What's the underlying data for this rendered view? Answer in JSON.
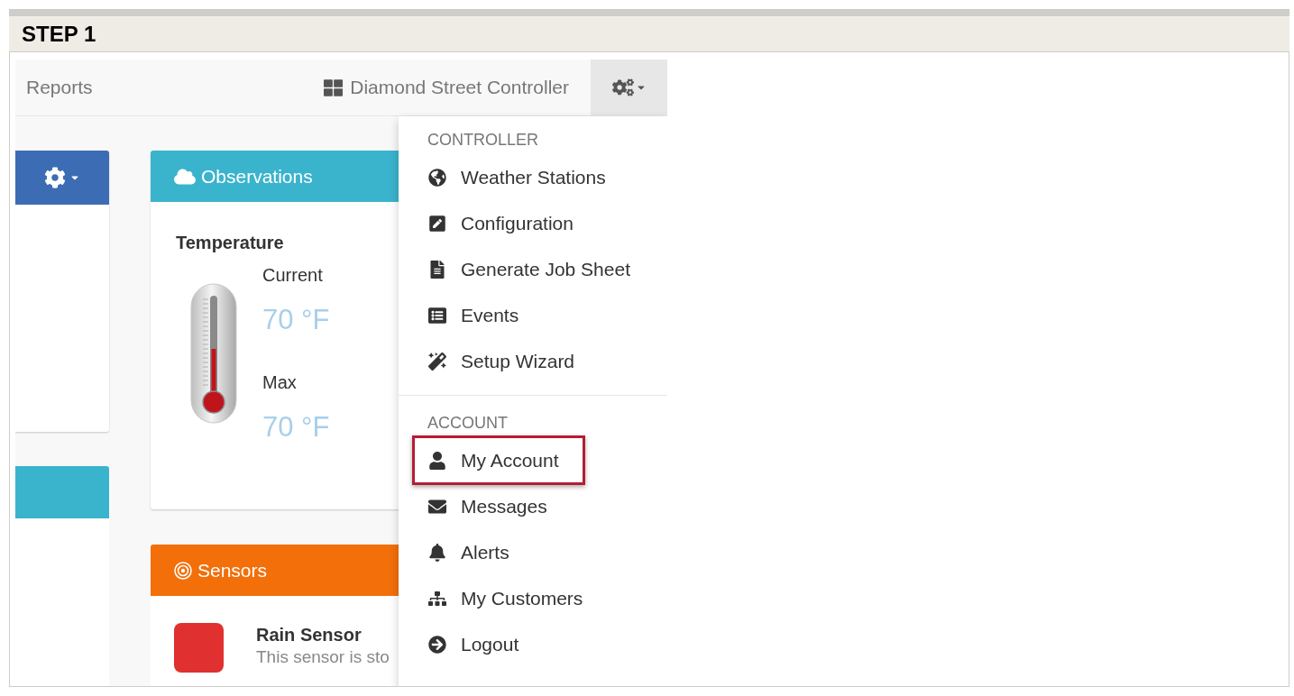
{
  "step_title": "STEP 1",
  "navbar": {
    "reports": "Reports",
    "controller_name": "Diamond Street Controller",
    "settings_menu_open": true
  },
  "observations": {
    "title": "Observations",
    "section": "Temperature",
    "thermometer": {
      "level": 0.45
    },
    "readings": [
      {
        "label": "Current",
        "value": "70 °F"
      },
      {
        "label": "Max",
        "value": "70 °F"
      }
    ]
  },
  "sensors": {
    "title": "Sensors",
    "items": [
      {
        "name": "Rain Sensor",
        "description": "This sensor is sto",
        "color": "#e03030"
      }
    ]
  },
  "menu": {
    "sections": [
      {
        "header": "CONTROLLER",
        "items": [
          {
            "label": "Weather Stations",
            "highlighted": false
          },
          {
            "label": "Configuration",
            "highlighted": false
          },
          {
            "label": "Generate Job Sheet",
            "highlighted": false
          },
          {
            "label": "Events",
            "highlighted": false
          },
          {
            "label": "Setup Wizard",
            "highlighted": false
          }
        ]
      },
      {
        "header": "ACCOUNT",
        "items": [
          {
            "label": "My Account",
            "highlighted": true
          },
          {
            "label": "Messages",
            "highlighted": false
          },
          {
            "label": "Alerts",
            "highlighted": false
          },
          {
            "label": "My Customers",
            "highlighted": false
          },
          {
            "label": "Logout",
            "highlighted": false
          }
        ]
      }
    ]
  }
}
